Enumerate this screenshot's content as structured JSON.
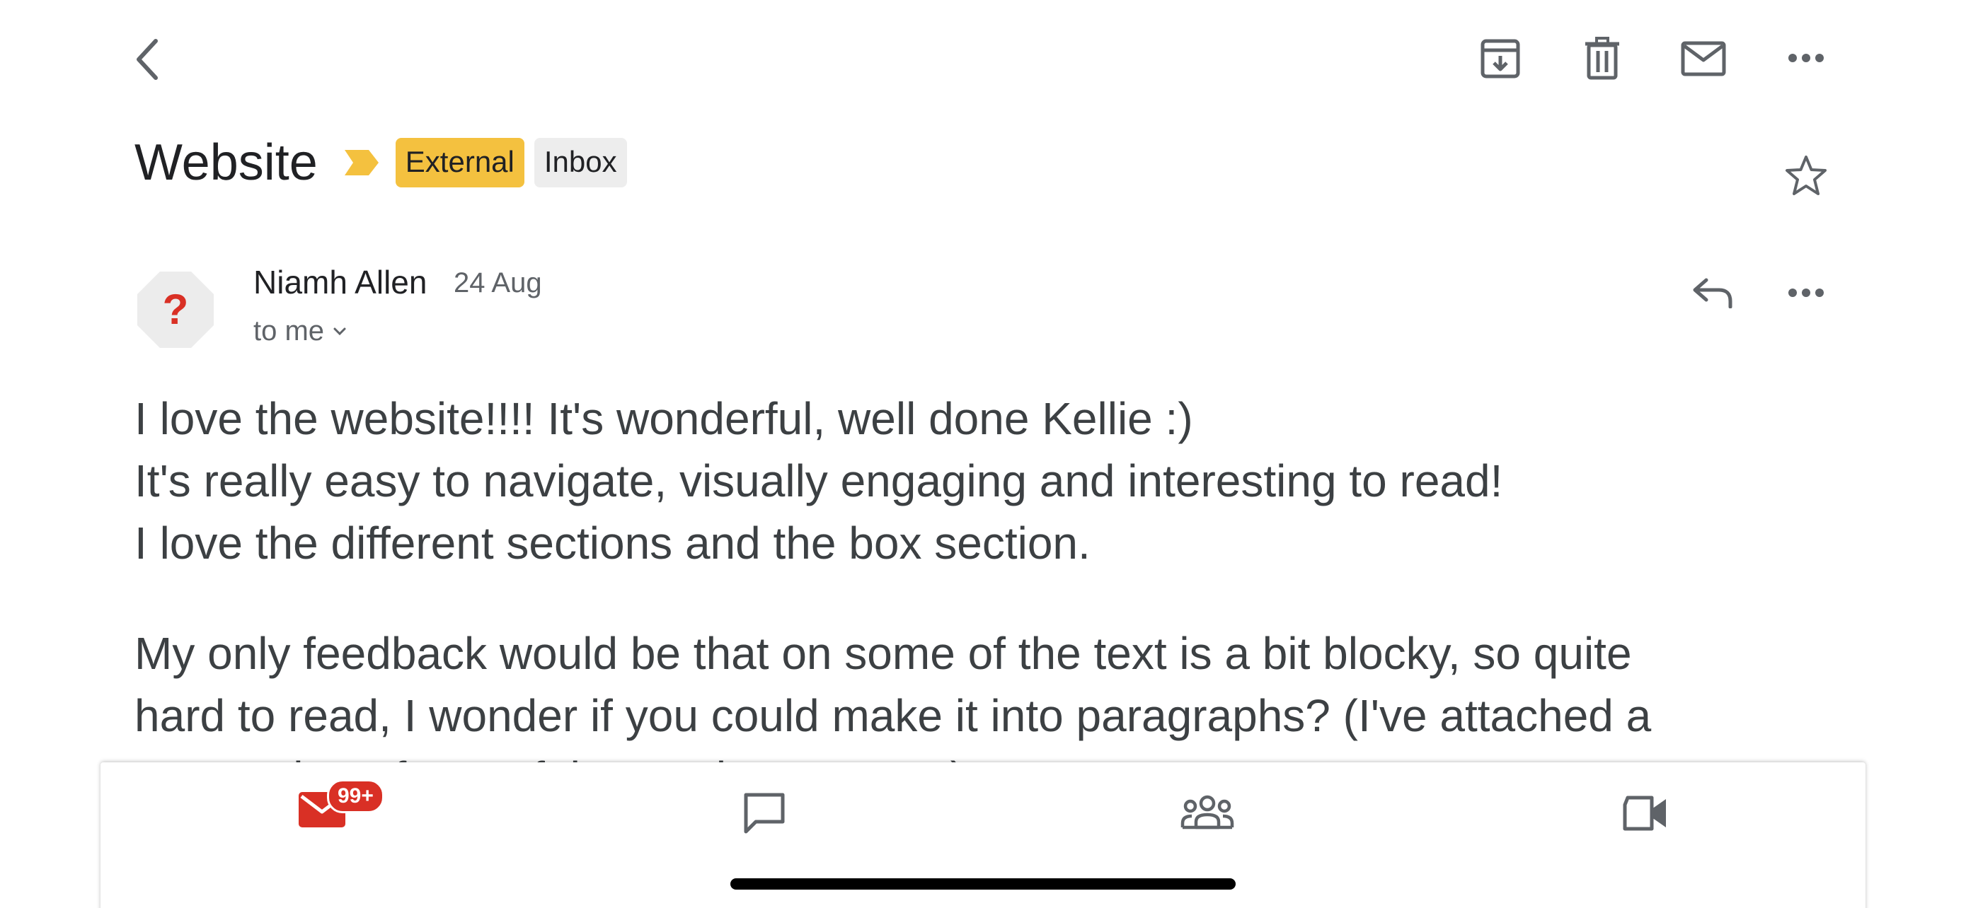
{
  "email": {
    "subject": "Website",
    "labels": [
      {
        "text": "External",
        "color": "#f4c13f"
      },
      {
        "text": "Inbox",
        "color": "#ededed"
      }
    ],
    "sender": {
      "name": "Niamh Allen",
      "date": "24 Aug",
      "recipient": "to me",
      "avatar_glyph": "?"
    },
    "body": {
      "lines": [
        "I love the website!!!! It's wonderful, well done Kellie :)",
        "It's really easy to navigate, visually engaging and interesting to read!",
        "I love the different sections and the box section.",
        "My only feedback would be that on some of the text is a bit blocky, so quite",
        "hard to read, I wonder if you could make it into paragraphs? (I've attached a",
        "screenshot of one of the sections I mean)"
      ]
    }
  },
  "toolbar": {
    "icons": [
      "back-arrow-icon",
      "archive-icon",
      "trash-icon",
      "mail-icon",
      "more-icon"
    ]
  },
  "bottom_nav": {
    "mail_badge": "99+",
    "tabs": [
      "mail-icon",
      "chat-icon",
      "spaces-icon",
      "meet-icon"
    ],
    "accent_color": "#d93025"
  }
}
